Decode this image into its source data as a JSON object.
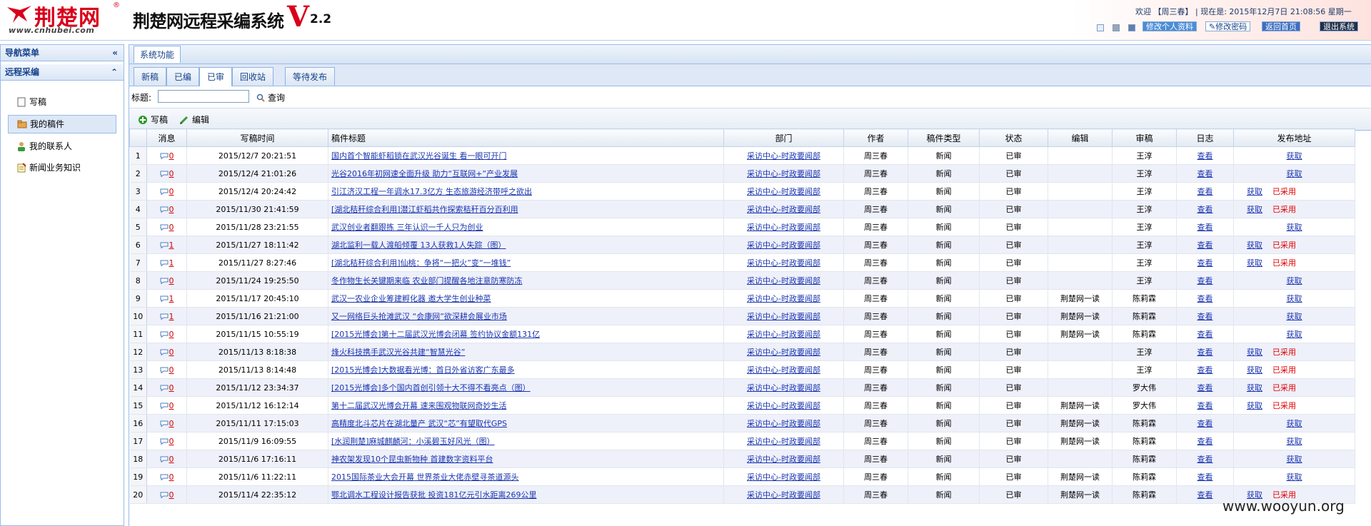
{
  "header": {
    "logo_text": "荆楚网",
    "logo_reg": "®",
    "logo_url": "www.cnhubei.com",
    "system_title": "荆楚网远程采编系统",
    "version_letter": "V",
    "version_number": "2.2",
    "welcome_prefix": "欢迎 【",
    "user_name": "周三春",
    "welcome_suffix": "】 | 现在是: 2015年12月7日 21:08:56 星期一",
    "buttons": {
      "edit_profile": "修改个人资料",
      "change_password": "修改密码",
      "home": "返回首页",
      "logout": "退出系统"
    },
    "colors": {
      "brand_red": "#d9001b",
      "header_border": "#b7cde8"
    }
  },
  "sidebar": {
    "nav_title": "导航菜单",
    "section_title": "远程采编",
    "items": [
      {
        "label": "写稿",
        "icon": "page-icon"
      },
      {
        "label": "我的稿件",
        "icon": "folder-icon"
      },
      {
        "label": "我的联系人",
        "icon": "user-icon"
      },
      {
        "label": "新闻业务知识",
        "icon": "notepad-icon"
      }
    ]
  },
  "main": {
    "panel_tab": "系统功能",
    "tabs": [
      {
        "label": "新稿"
      },
      {
        "label": "已编"
      },
      {
        "label": "已审"
      },
      {
        "label": "回收站"
      },
      {
        "label": "等待发布"
      }
    ],
    "active_tab": "已审",
    "search": {
      "label": "标题:",
      "value": "",
      "button": "查询"
    },
    "toolbar": {
      "write": "写稿",
      "edit": "编辑"
    }
  },
  "grid": {
    "columns": [
      "消息",
      "写稿时间",
      "稿件标题",
      "部门",
      "作者",
      "稿件类型",
      "状态",
      "编辑",
      "审稿",
      "日志",
      "发布地址"
    ],
    "view_label": "查看",
    "fetch_label": "获取",
    "adopted_label": "已采用",
    "rows": [
      {
        "no": "1",
        "msg": "0",
        "time": "2015/12/7 20:21:51",
        "title": "国内首个智能虾稻锁在武汉光谷诞生 看一眼可开门",
        "dept": "采访中心-时政要闻部",
        "author": "周三春",
        "type": "新闻",
        "status": "已审",
        "editor": "",
        "reviewer": "王淳",
        "adopted": false
      },
      {
        "no": "2",
        "msg": "0",
        "time": "2015/12/4 21:01:26",
        "title": "光谷2016年初网速全面升级 助力“互联网+”产业发展",
        "dept": "采访中心-时政要闻部",
        "author": "周三春",
        "type": "新闻",
        "status": "已审",
        "editor": "",
        "reviewer": "王淳",
        "adopted": false
      },
      {
        "no": "3",
        "msg": "0",
        "time": "2015/12/4 20:24:42",
        "title": "引江济汉工程一年调水17.3亿方 生态旅游经济带呼之欲出",
        "dept": "采访中心-时政要闻部",
        "author": "周三春",
        "type": "新闻",
        "status": "已审",
        "editor": "",
        "reviewer": "王淳",
        "adopted": true
      },
      {
        "no": "4",
        "msg": "0",
        "time": "2015/11/30 21:41:59",
        "title": "[湖北秸秆综合利用]潜江虾稻共作探索秸秆百分百利用",
        "dept": "采访中心-时政要闻部",
        "author": "周三春",
        "type": "新闻",
        "status": "已审",
        "editor": "",
        "reviewer": "王淳",
        "adopted": true
      },
      {
        "no": "5",
        "msg": "0",
        "time": "2015/11/28 23:21:55",
        "title": "武汉创业者翻跟拣 三年认识一千人只为创业",
        "dept": "采访中心-时政要闻部",
        "author": "周三春",
        "type": "新闻",
        "status": "已审",
        "editor": "",
        "reviewer": "王淳",
        "adopted": false
      },
      {
        "no": "6",
        "msg": "1",
        "time": "2015/11/27 18:11:42",
        "title": "湖北监利一载人渡船倾覆 13人获救1人失踪（图）",
        "dept": "采访中心-时政要闻部",
        "author": "周三春",
        "type": "新闻",
        "status": "已审",
        "editor": "",
        "reviewer": "王淳",
        "adopted": true
      },
      {
        "no": "7",
        "msg": "1",
        "time": "2015/11/27 8:27:46",
        "title": "[湖北秸秆综合利用]仙桃：争将“一把火”变“一堆钱”",
        "dept": "采访中心-时政要闻部",
        "author": "周三春",
        "type": "新闻",
        "status": "已审",
        "editor": "",
        "reviewer": "王淳",
        "adopted": true
      },
      {
        "no": "8",
        "msg": "0",
        "time": "2015/11/24 19:25:50",
        "title": "冬作物生长关键期来临 农业部门提醒各地注意防寒防冻",
        "dept": "采访中心-时政要闻部",
        "author": "周三春",
        "type": "新闻",
        "status": "已审",
        "editor": "",
        "reviewer": "王淳",
        "adopted": false
      },
      {
        "no": "9",
        "msg": "1",
        "time": "2015/11/17 20:45:10",
        "title": "武汉一农业企业筹建孵化器 邀大学生创业种菜",
        "dept": "采访中心-时政要闻部",
        "author": "周三春",
        "type": "新闻",
        "status": "已审",
        "editor": "荆楚网一读",
        "reviewer": "陈莉霖",
        "adopted": false
      },
      {
        "no": "10",
        "msg": "1",
        "time": "2015/11/16 21:21:00",
        "title": "又一网络巨头抢滩武汉 “会康网”欲深耕会展业市场",
        "dept": "采访中心-时政要闻部",
        "author": "周三春",
        "type": "新闻",
        "status": "已审",
        "editor": "荆楚网一读",
        "reviewer": "陈莉霖",
        "adopted": false
      },
      {
        "no": "11",
        "msg": "0",
        "time": "2015/11/15 10:55:19",
        "title": "[2015光博会]第十二届武汉光博会闭幕 签约协议金额131亿",
        "dept": "采访中心-时政要闻部",
        "author": "周三春",
        "type": "新闻",
        "status": "已审",
        "editor": "荆楚网一读",
        "reviewer": "陈莉霖",
        "adopted": false
      },
      {
        "no": "12",
        "msg": "0",
        "time": "2015/11/13 8:18:38",
        "title": "烽火科技携手武汉光谷共建“智慧光谷”",
        "dept": "采访中心-时政要闻部",
        "author": "周三春",
        "type": "新闻",
        "status": "已审",
        "editor": "",
        "reviewer": "王淳",
        "adopted": true
      },
      {
        "no": "13",
        "msg": "0",
        "time": "2015/11/13 8:14:48",
        "title": "[2015光博会]大数据看光博：首日外省访客广东最多",
        "dept": "采访中心-时政要闻部",
        "author": "周三春",
        "type": "新闻",
        "status": "已审",
        "editor": "",
        "reviewer": "王淳",
        "adopted": true
      },
      {
        "no": "14",
        "msg": "0",
        "time": "2015/11/12 23:34:37",
        "title": "[2015光博会]多个国内首创引领十大不得不看亮点（图）",
        "dept": "采访中心-时政要闻部",
        "author": "周三春",
        "type": "新闻",
        "status": "已审",
        "editor": "",
        "reviewer": "罗大伟",
        "adopted": true
      },
      {
        "no": "15",
        "msg": "0",
        "time": "2015/11/12 16:12:14",
        "title": "第十二届武汉光博会开幕 速来围观物联网奇妙生活",
        "dept": "采访中心-时政要闻部",
        "author": "周三春",
        "type": "新闻",
        "status": "已审",
        "editor": "荆楚网一读",
        "reviewer": "罗大伟",
        "adopted": true
      },
      {
        "no": "16",
        "msg": "0",
        "time": "2015/11/11 17:15:03",
        "title": "高精度北斗芯片在湖北量产 武汉“芯”有望取代GPS",
        "dept": "采访中心-时政要闻部",
        "author": "周三春",
        "type": "新闻",
        "status": "已审",
        "editor": "荆楚网一读",
        "reviewer": "陈莉霖",
        "adopted": false
      },
      {
        "no": "17",
        "msg": "0",
        "time": "2015/11/9 16:09:55",
        "title": "[水润荆楚]麻城麒麟河：小溪碧玉好风光（图）",
        "dept": "采访中心-时政要闻部",
        "author": "周三春",
        "type": "新闻",
        "status": "已审",
        "editor": "荆楚网一读",
        "reviewer": "陈莉霖",
        "adopted": false
      },
      {
        "no": "18",
        "msg": "0",
        "time": "2015/11/6 17:16:11",
        "title": "神农架发现10个昆虫新物种 首建数字资料平台",
        "dept": "采访中心-时政要闻部",
        "author": "周三春",
        "type": "新闻",
        "status": "已审",
        "editor": "",
        "reviewer": "陈莉霖",
        "adopted": false
      },
      {
        "no": "19",
        "msg": "0",
        "time": "2015/11/6 11:22:11",
        "title": "2015国际茶业大会开幕 世界茶业大佬赤壁寻茶道源头",
        "dept": "采访中心-时政要闻部",
        "author": "周三春",
        "type": "新闻",
        "status": "已审",
        "editor": "荆楚网一读",
        "reviewer": "陈莉霖",
        "adopted": false
      },
      {
        "no": "20",
        "msg": "0",
        "time": "2015/11/4 22:35:12",
        "title": "鄂北调水工程设计报告获批 投资181亿元引水距离269公里",
        "dept": "采访中心-时政要闻部",
        "author": "周三春",
        "type": "新闻",
        "status": "已审",
        "editor": "荆楚网一读",
        "reviewer": "陈莉霖",
        "adopted": true
      }
    ]
  },
  "watermark": "www.wooyun.org"
}
